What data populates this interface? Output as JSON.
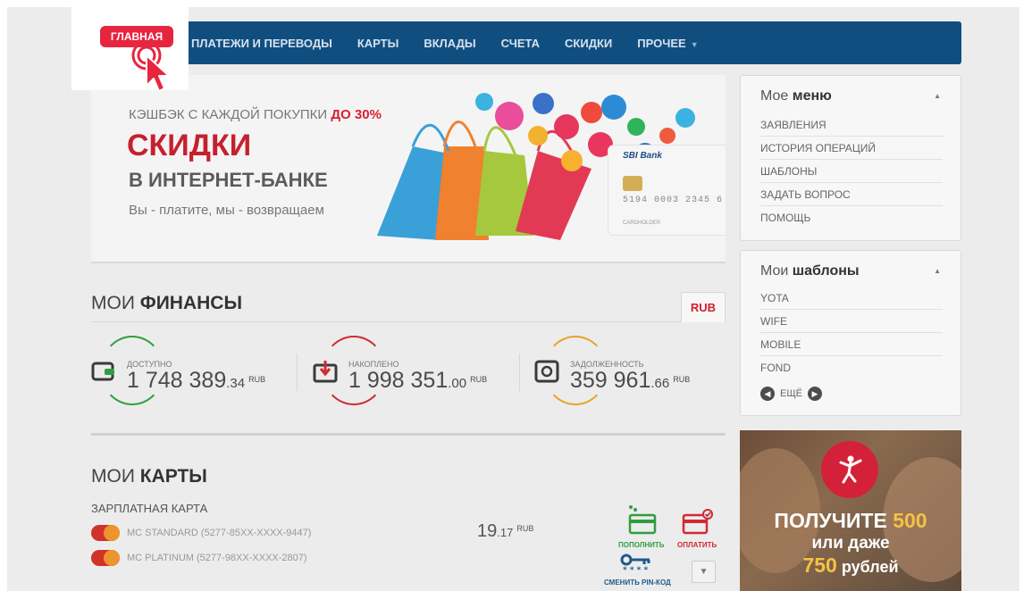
{
  "nav": {
    "home": "ГЛАВНАЯ",
    "items": [
      "ПЛАТЕЖИ И ПЕРЕВОДЫ",
      "КАРТЫ",
      "ВКЛАДЫ",
      "СЧЕТА",
      "СКИДКИ"
    ],
    "more": "ПРОЧЕЕ"
  },
  "banner": {
    "line1_prefix": "КЭШБЭК С КАЖДОЙ ПОКУПКИ",
    "line1_accent": "ДО 30%",
    "line2": "СКИДКИ",
    "line3": "В ИНТЕРНЕТ-БАНКЕ",
    "line4": "Вы - платите, мы - возвращаем",
    "card_bank": "SBI Bank",
    "card_number": "5194 0003 2345 6",
    "card_holder": "CARDHOLDER"
  },
  "finances": {
    "title_light": "МОИ",
    "title_bold": "ФИНАНСЫ",
    "currency_tab": "RUB",
    "items": [
      {
        "label": "ДОСТУПНО",
        "amount": "1 748 389",
        "cents": ".34",
        "currency": "RUB",
        "color": "#2e9e3f"
      },
      {
        "label": "НАКОПЛЕНО",
        "amount": "1 998 351",
        "cents": ".00",
        "currency": "RUB",
        "color": "#d02a34"
      },
      {
        "label": "ЗАДОЛЖЕННОСТЬ",
        "amount": "359 961",
        "cents": ".66",
        "currency": "RUB",
        "color": "#e8a326"
      }
    ]
  },
  "cards": {
    "title_light": "МОИ",
    "title_bold": "КАРТЫ",
    "group": "ЗАРПЛАТНАЯ КАРТА",
    "list": [
      {
        "name": "MC STANDARD (5277-85XX-XXXX-9447)"
      },
      {
        "name": "MC PLATINUM (5277-98XX-XXXX-2807)"
      }
    ],
    "balance": "19",
    "balance_cents": ".17",
    "balance_currency": "RUB",
    "actions": {
      "topup": "ПОПОЛНИТЬ",
      "pay": "ОПЛАТИТЬ",
      "pin": "СМЕНИТЬ PIN-КОД"
    }
  },
  "menu": {
    "title_light": "Мое",
    "title_bold": "меню",
    "items": [
      "ЗАЯВЛЕНИЯ",
      "ИСТОРИЯ ОПЕРАЦИЙ",
      "ШАБЛОНЫ",
      "ЗАДАТЬ ВОПРОС",
      "ПОМОЩЬ"
    ]
  },
  "templates": {
    "title_light": "Мои",
    "title_bold": "шаблоны",
    "items": [
      "YOTA",
      "WIFE",
      "MOBILE",
      "FOND"
    ],
    "more": "ЕЩЁ"
  },
  "promo": {
    "line1_prefix": "ПОЛУЧИТЕ",
    "line1_accent": "500",
    "line2": "или даже",
    "line3_accent": "750",
    "line3_suffix": "рублей"
  },
  "colors": {
    "nav_bg": "#114e80",
    "brand_red": "#e8253f",
    "green": "#2e9e3f",
    "red": "#d02a34",
    "orange": "#e8a326"
  },
  "icons": [
    "cursor-hand-icon",
    "wallet-icon",
    "download-box-icon",
    "safe-icon",
    "mastercard-logo-icon",
    "card-topup-icon",
    "card-pay-icon",
    "key-icon",
    "chevron-down-icon",
    "arrow-left-icon",
    "arrow-right-icon",
    "dancer-icon"
  ]
}
